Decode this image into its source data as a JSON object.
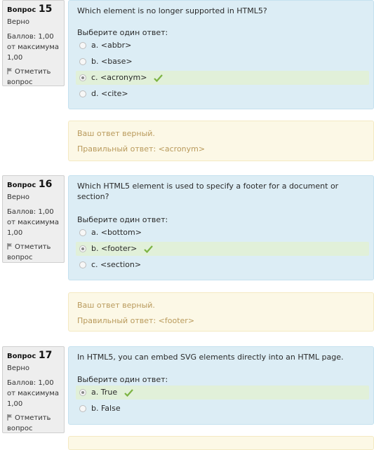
{
  "questions": [
    {
      "title": "Вопрос",
      "number": "15",
      "state": "Верно",
      "grade": "Баллов: 1,00 от максимума 1,00",
      "flag_label": "Отметить вопрос",
      "text": "Which element is no longer supported in HTML5?",
      "prompt": "Выберите один ответ:",
      "answers": [
        {
          "label": "a. <abbr>"
        },
        {
          "label": "b. <base>"
        },
        {
          "label": "c. <acronym>"
        },
        {
          "label": "d. <cite>"
        }
      ],
      "feedback_status": "Ваш ответ верный.",
      "feedback_correct": "Правильный ответ: <acronym>"
    },
    {
      "title": "Вопрос",
      "number": "16",
      "state": "Верно",
      "grade": "Баллов: 1,00 от максимума 1,00",
      "flag_label": "Отметить вопрос",
      "text": "Which HTML5 element is used to specify a footer for a document or section?",
      "prompt": "Выберите один ответ:",
      "answers": [
        {
          "label": "a. <bottom>"
        },
        {
          "label": "b. <footer>"
        },
        {
          "label": "c. <section>"
        }
      ],
      "feedback_status": "Ваш ответ верный.",
      "feedback_correct": "Правильный ответ: <footer>"
    },
    {
      "title": "Вопрос",
      "number": "17",
      "state": "Верно",
      "grade": "Баллов: 1,00 от максимума 1,00",
      "flag_label": "Отметить вопрос",
      "text": "In HTML5, you can embed SVG elements directly into an HTML page.",
      "prompt": "Выберите один ответ:",
      "answers": [
        {
          "label": "a. True"
        },
        {
          "label": "b. False"
        }
      ]
    }
  ],
  "colors": {
    "info_bg": "#eeeeee",
    "content_bg": "#dcedf5",
    "correct_bg": "#e1f0d9",
    "feedback_bg": "#fcf8e6",
    "feedback_text": "#b99a5c",
    "check": "#7cb342"
  }
}
